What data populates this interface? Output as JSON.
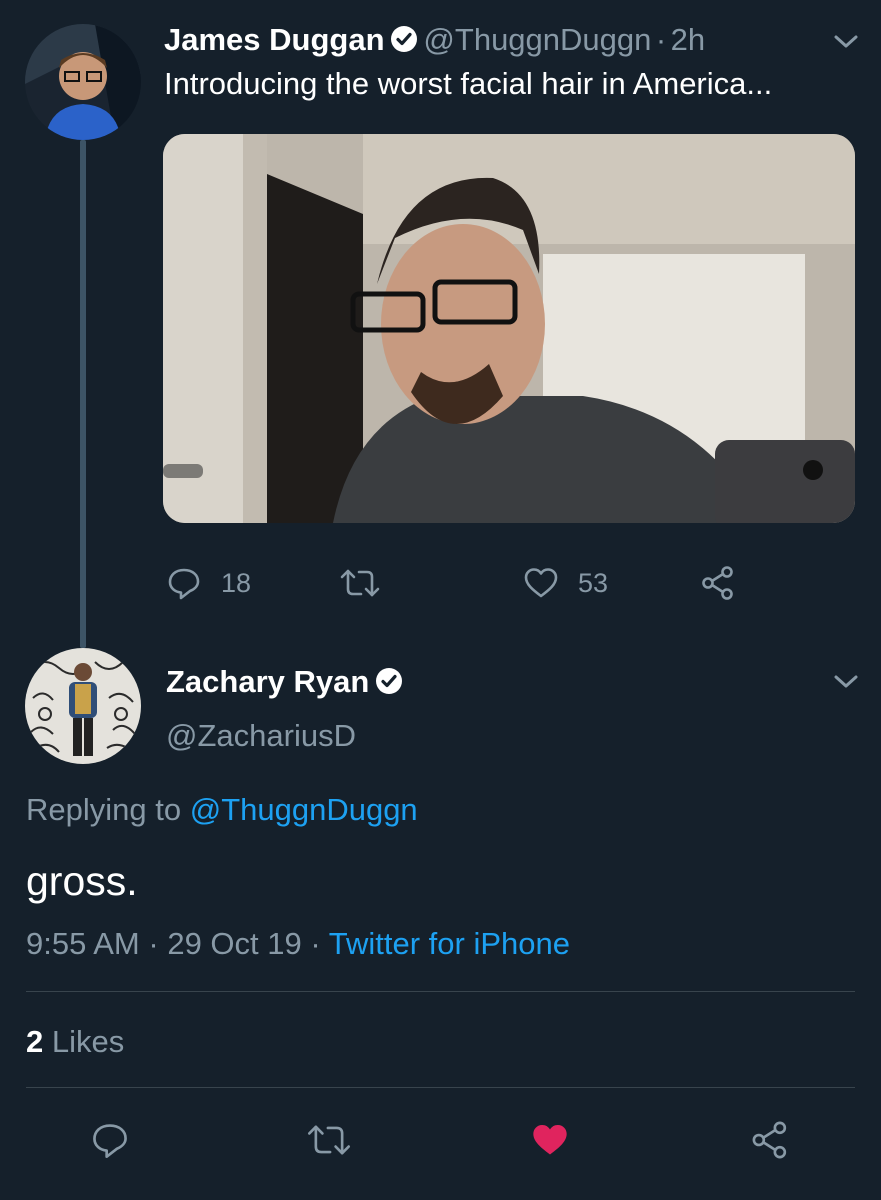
{
  "tweet": {
    "author_name": "James Duggan",
    "handle": "@ThuggnDuggn",
    "separator": "·",
    "time": "2h",
    "text": "Introducing the worst facial hair in America...",
    "replies": "18",
    "likes": "53"
  },
  "reply": {
    "author_name": "Zachary Ryan",
    "handle": "@ZachariusD",
    "replying_prefix": "Replying to",
    "replying_handle": "@ThuggnDuggn",
    "text": "gross.",
    "time": "9:55 AM",
    "separator1": "·",
    "date": "29 Oct 19",
    "separator2": "·",
    "source": "Twitter for iPhone",
    "likes_count": "2",
    "likes_label": "Likes"
  },
  "colors": {
    "background": "#15202b",
    "muted": "#8899a6",
    "accent": "#1da1f2",
    "like_active": "#e0245e",
    "divider": "#38444d"
  },
  "icons": [
    "verified-badge-icon",
    "chevron-down-icon",
    "reply-icon",
    "retweet-icon",
    "like-icon",
    "share-icon",
    "liked-heart-icon"
  ]
}
